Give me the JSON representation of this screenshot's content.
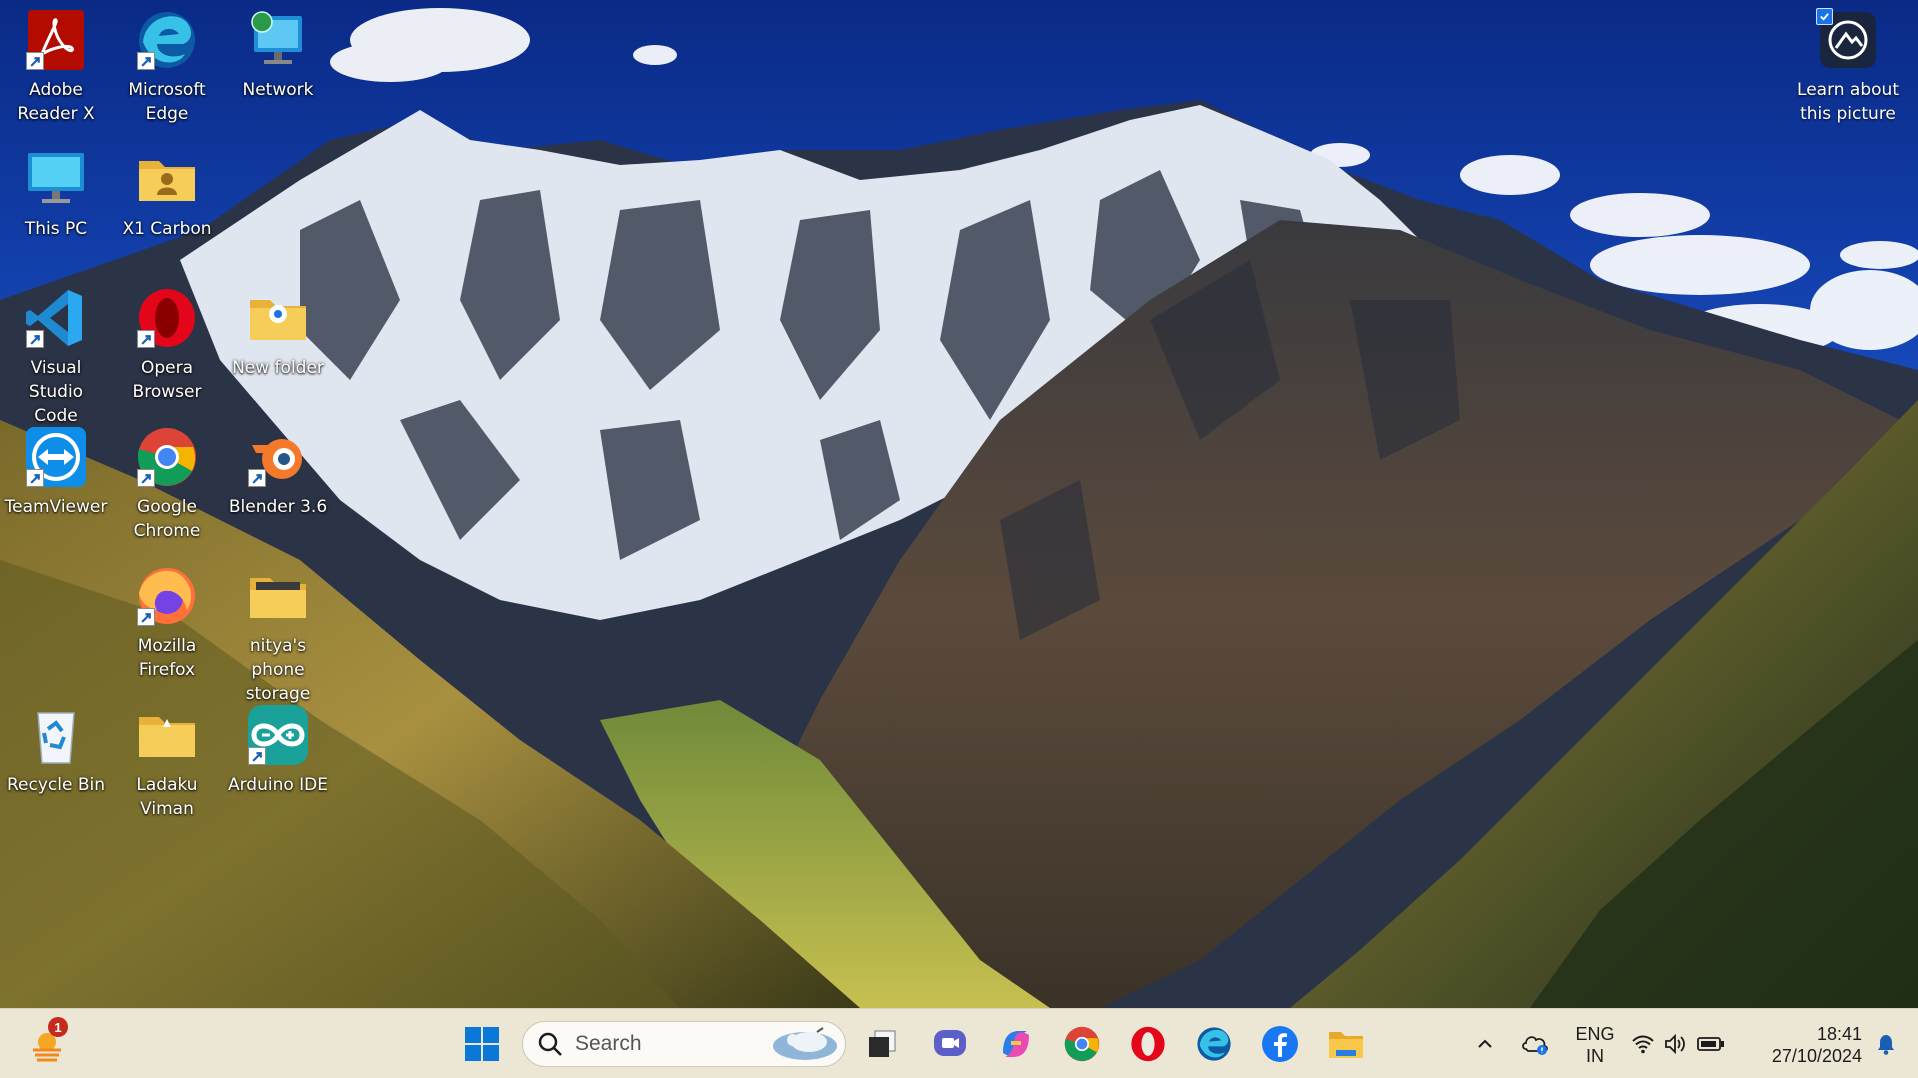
{
  "desktop": {
    "icons": [
      {
        "id": "adobe-reader",
        "label": "Adobe\nReader X"
      },
      {
        "id": "microsoft-edge",
        "label": "Microsoft\nEdge"
      },
      {
        "id": "network",
        "label": "Network"
      },
      {
        "id": "this-pc",
        "label": "This PC"
      },
      {
        "id": "x1-carbon",
        "label": "X1 Carbon"
      },
      {
        "id": "visual-studio-code",
        "label": "Visual Studio\nCode"
      },
      {
        "id": "opera-browser",
        "label": "Opera\nBrowser"
      },
      {
        "id": "new-folder",
        "label": "New folder"
      },
      {
        "id": "teamviewer",
        "label": "TeamViewer"
      },
      {
        "id": "google-chrome",
        "label": "Google\nChrome"
      },
      {
        "id": "blender",
        "label": "Blender 3.6"
      },
      {
        "id": "mozilla-firefox",
        "label": "Mozilla\nFirefox"
      },
      {
        "id": "phone-storage",
        "label": "nitya's phone\nstorage"
      },
      {
        "id": "recycle-bin",
        "label": "Recycle Bin"
      },
      {
        "id": "ladaku-viman",
        "label": "Ladaku\nViman"
      },
      {
        "id": "arduino-ide",
        "label": "Arduino IDE"
      }
    ],
    "spotlight": {
      "label": "Learn about\nthis picture"
    }
  },
  "taskbar": {
    "weather_badge": "1",
    "search_placeholder": "Search",
    "pinned": [
      "start-icon",
      "task-view-icon",
      "meet-icon",
      "copilot-icon",
      "chrome-icon",
      "opera-icon",
      "edge-icon",
      "facebook-icon",
      "file-explorer-icon"
    ],
    "tray": {
      "language_line1": "ENG",
      "language_line2": "IN",
      "time": "18:41",
      "date": "27/10/2024"
    }
  },
  "colors": {
    "taskbar_bg": "#ece7d5",
    "sky_top": "#0a2f8f",
    "accent_blue": "#1a73e8"
  }
}
